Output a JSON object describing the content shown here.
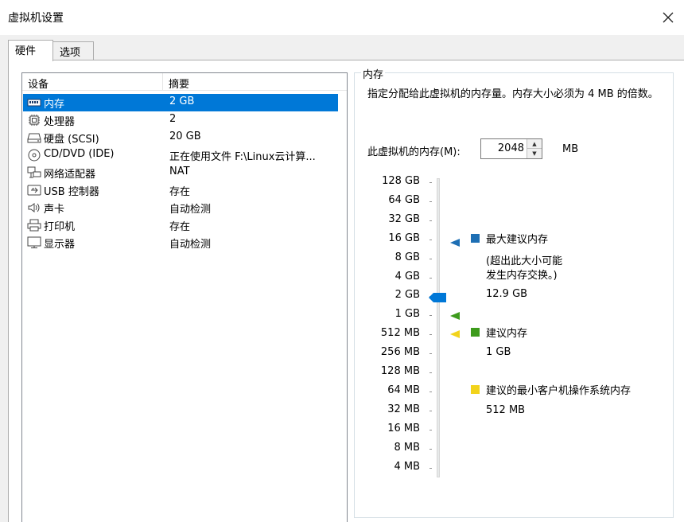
{
  "window": {
    "title": "虚拟机设置"
  },
  "tabs": [
    {
      "label": "硬件"
    },
    {
      "label": "选项"
    }
  ],
  "device_list": {
    "columns": {
      "device": "设备",
      "summary": "摘要"
    },
    "rows": [
      {
        "device": "内存",
        "summary": "2 GB",
        "icon": "memory-icon",
        "selected": true
      },
      {
        "device": "处理器",
        "summary": "2",
        "icon": "processor-icon"
      },
      {
        "device": "硬盘 (SCSI)",
        "summary": "20 GB",
        "icon": "hard-disk-icon"
      },
      {
        "device": "CD/DVD (IDE)",
        "summary": "正在使用文件 F:\\Linux云计算...",
        "icon": "cd-dvd-icon"
      },
      {
        "device": "网络适配器",
        "summary": "NAT",
        "icon": "network-adapter-icon"
      },
      {
        "device": "USB 控制器",
        "summary": "存在",
        "icon": "usb-icon"
      },
      {
        "device": "声卡",
        "summary": "自动检测",
        "icon": "speaker-icon"
      },
      {
        "device": "打印机",
        "summary": "存在",
        "icon": "printer-icon"
      },
      {
        "device": "显示器",
        "summary": "自动检测",
        "icon": "monitor-icon"
      }
    ]
  },
  "memory": {
    "group_title": "内存",
    "description": "指定分配给此虚拟机的内存量。内存大小必须为 4 MB 的倍数。",
    "input_label": "此虚拟机的内存(M):",
    "value": "2048",
    "unit": "MB",
    "scale": [
      "128 GB",
      "64 GB",
      "32 GB",
      "16 GB",
      "8 GB",
      "4 GB",
      "2 GB",
      "1 GB",
      "512 MB",
      "256 MB",
      "128 MB",
      "64 MB",
      "32 MB",
      "16 MB",
      "8 MB",
      "4 MB"
    ],
    "current_level": "2 GB",
    "legend": {
      "max": {
        "label": "最大建议内存",
        "note_line1": "(超出此大小可能",
        "note_line2": "发生内存交换。)",
        "value": "12.9 GB",
        "color": "#1e6fb4"
      },
      "recommended": {
        "label": "建议内存",
        "value": "1 GB",
        "color": "#3d9b1c"
      },
      "min": {
        "label": "建议的最小客户机操作系统内存",
        "value": "512 MB",
        "color": "#f2d31b"
      }
    },
    "thumb_color": "#0078d7"
  }
}
